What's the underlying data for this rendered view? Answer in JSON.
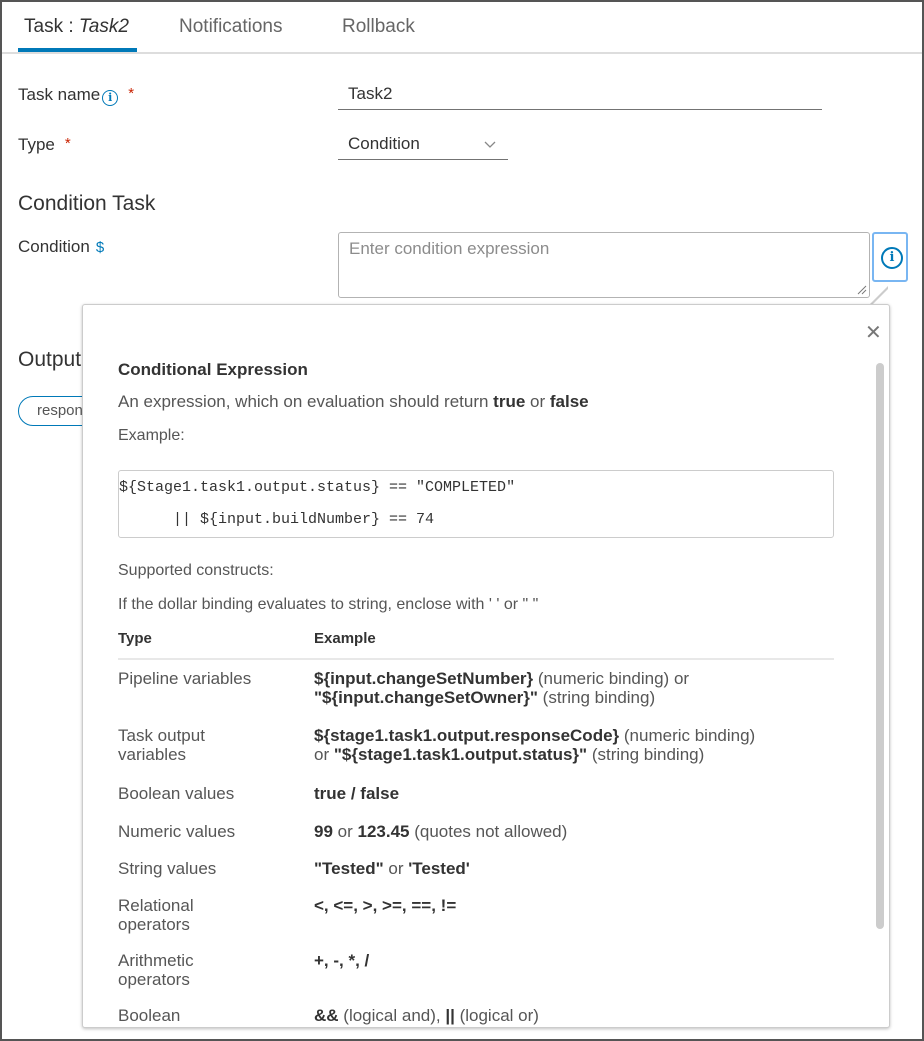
{
  "tabs": [
    {
      "label_prefix": "Task : ",
      "label_italic": "Task2",
      "active": true
    },
    {
      "label": "Notifications",
      "active": false
    },
    {
      "label": "Rollback",
      "active": false
    }
  ],
  "form": {
    "task_name_label": "Task name",
    "task_name_value": "Task2",
    "required_mark": "*",
    "info_icon_glyph": "i",
    "type_label": "Type",
    "type_value": "Condition",
    "chevron_glyph": "⌄",
    "section_title": "Condition Task",
    "condition_label": "Condition",
    "dollar_glyph": "$",
    "condition_placeholder": "Enter condition expression",
    "output_title": "Output",
    "output_chip": "response"
  },
  "popover": {
    "close_glyph": "✕",
    "title": "Conditional Expression",
    "desc_prefix": "An expression, which on evaluation should return ",
    "desc_true": "true",
    "desc_or": " or ",
    "desc_false": "false",
    "example_label": "Example:",
    "code_line1": "${Stage1.task1.output.status} == \"COMPLETED\"",
    "code_line2": "      || ${input.buildNumber} == 74",
    "supported": "Supported constructs:",
    "string_note": "If the dollar binding evaluates to string, enclose with ' ' or \" \"",
    "col_type": "Type",
    "col_example": "Example",
    "rows": [
      {
        "type": "Pipeline variables",
        "ex": [
          {
            "b": "${input.changeSetNumber}"
          },
          {
            "t": " (numeric binding) or "
          },
          {
            "br": true
          },
          {
            "b": "\"${input.changeSetOwner}\""
          },
          {
            "t": " (string binding)"
          }
        ]
      },
      {
        "type": "Task output variables",
        "ex": [
          {
            "b": "${stage1.task1.output.responseCode}"
          },
          {
            "t": " (numeric binding)"
          },
          {
            "br": true
          },
          {
            "t": "or "
          },
          {
            "b": "\"${stage1.task1.output.status}\""
          },
          {
            "t": " (string binding)"
          }
        ]
      },
      {
        "type": "Boolean values",
        "ex": [
          {
            "b": "true / false"
          }
        ]
      },
      {
        "type": "Numeric values",
        "ex": [
          {
            "b": "99"
          },
          {
            "t": " or "
          },
          {
            "b": "123.45"
          },
          {
            "t": " (quotes not allowed)"
          }
        ]
      },
      {
        "type": "String values",
        "ex": [
          {
            "b": "\"Tested\""
          },
          {
            "t": " or "
          },
          {
            "b": "'Tested'"
          }
        ]
      },
      {
        "type": "Relational operators",
        "ex": [
          {
            "b": "<, <=, >, >=, ==, !="
          }
        ]
      },
      {
        "type": "Arithmetic operators",
        "ex": [
          {
            "b": "+, -, *, /"
          }
        ]
      },
      {
        "type": "Boolean Operators",
        "ex": [
          {
            "b": "&&"
          },
          {
            "t": " (logical and), "
          },
          {
            "b": "||"
          },
          {
            "t": " (logical or)"
          }
        ]
      }
    ]
  }
}
